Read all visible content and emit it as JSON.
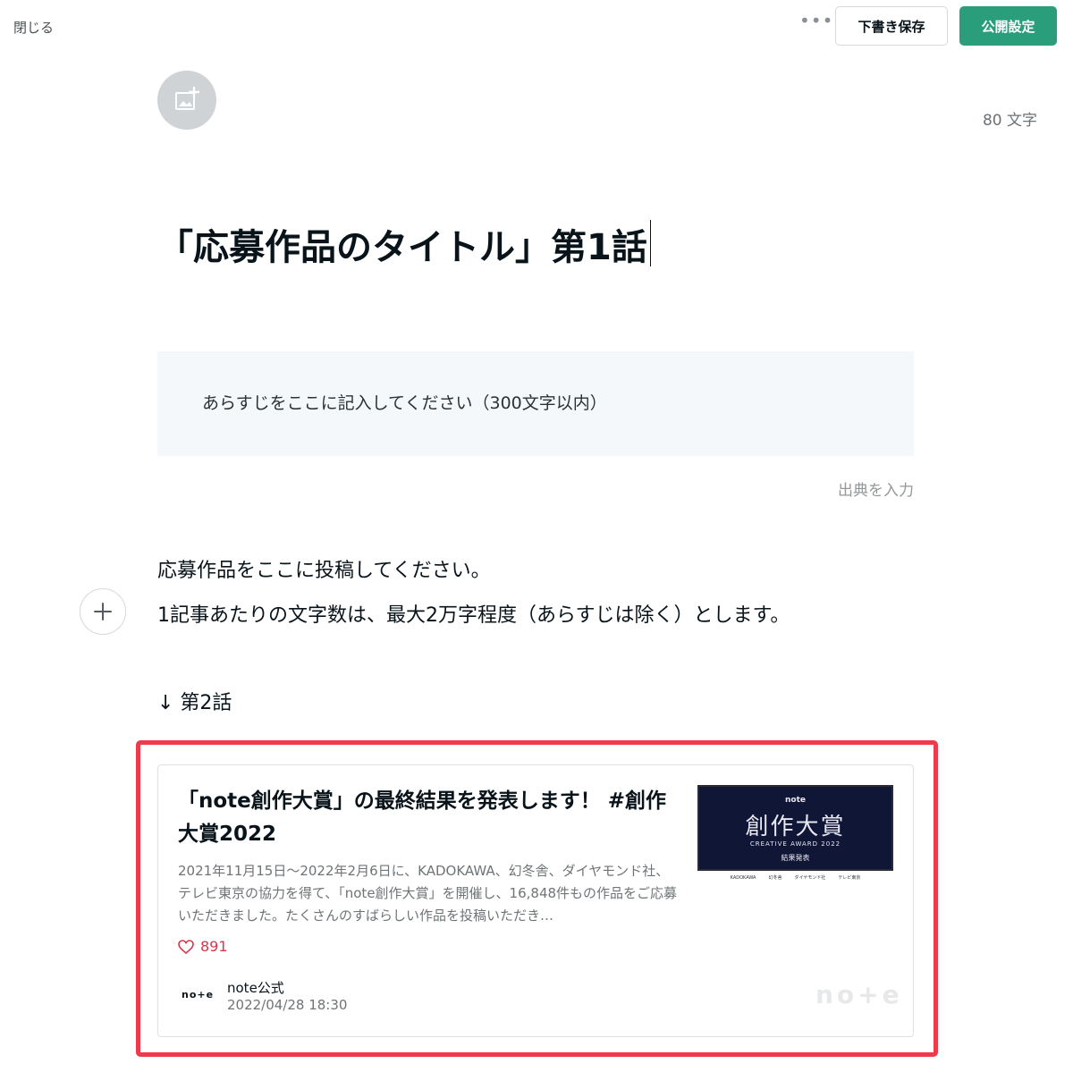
{
  "header": {
    "close_label": "閉じる",
    "more_label": "•••",
    "draft_label": "下書き保存",
    "publish_label": "公開設定"
  },
  "editor": {
    "char_count": "80 文字",
    "title": "「応募作品のタイトル」第1話",
    "synopsis_placeholder": "あらすじをここに記入してください（300文字以内）",
    "source_placeholder": "出典を入力",
    "body_lines": [
      "応募作品をここに投稿してください。",
      "1記事あたりの文字数は、最大2万字程度（あらすじは除く）とします。"
    ],
    "next_link": "↓ 第2話"
  },
  "embed_card": {
    "title": "「note創作大賞」の最終結果を発表します！ #創作大賞2022",
    "description": "2021年11月15日〜2022年2月6日に、KADOKAWA、幻冬舎、ダイヤモンド社、テレビ東京の協力を得て、「note創作大賞」を開催し、16,848件もの作品をご応募いただきました。たくさんのすばらしい作品を投稿いただき…",
    "likes": "891",
    "author": "note公式",
    "date": "2022/04/28 18:30",
    "author_logo": "no+e",
    "brand": "no+e",
    "thumbnail": {
      "logo": "note",
      "heading": "創作大賞",
      "subheading": "CREATIVE AWARD 2022",
      "result": "結果発表",
      "sponsors": [
        "KADOKAWA",
        "幻冬舎",
        "ダイヤモンド社",
        "テレビ東京"
      ]
    }
  },
  "colors": {
    "accent": "#2a9d7a",
    "highlight": "#ef3a4b",
    "like": "#d8354a"
  }
}
